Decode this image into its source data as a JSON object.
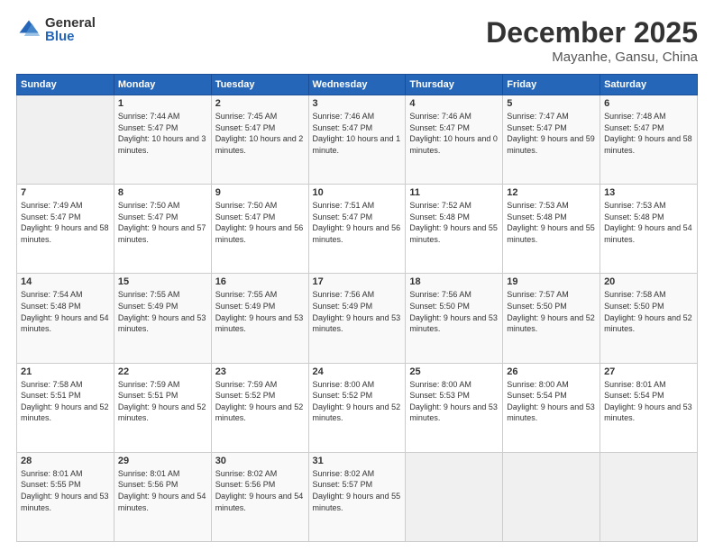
{
  "logo": {
    "general": "General",
    "blue": "Blue"
  },
  "header": {
    "month": "December 2025",
    "location": "Mayanhe, Gansu, China"
  },
  "days_of_week": [
    "Sunday",
    "Monday",
    "Tuesday",
    "Wednesday",
    "Thursday",
    "Friday",
    "Saturday"
  ],
  "weeks": [
    [
      {
        "day": "",
        "sunrise": "",
        "sunset": "",
        "daylight": ""
      },
      {
        "day": "1",
        "sunrise": "Sunrise: 7:44 AM",
        "sunset": "Sunset: 5:47 PM",
        "daylight": "Daylight: 10 hours and 3 minutes."
      },
      {
        "day": "2",
        "sunrise": "Sunrise: 7:45 AM",
        "sunset": "Sunset: 5:47 PM",
        "daylight": "Daylight: 10 hours and 2 minutes."
      },
      {
        "day": "3",
        "sunrise": "Sunrise: 7:46 AM",
        "sunset": "Sunset: 5:47 PM",
        "daylight": "Daylight: 10 hours and 1 minute."
      },
      {
        "day": "4",
        "sunrise": "Sunrise: 7:46 AM",
        "sunset": "Sunset: 5:47 PM",
        "daylight": "Daylight: 10 hours and 0 minutes."
      },
      {
        "day": "5",
        "sunrise": "Sunrise: 7:47 AM",
        "sunset": "Sunset: 5:47 PM",
        "daylight": "Daylight: 9 hours and 59 minutes."
      },
      {
        "day": "6",
        "sunrise": "Sunrise: 7:48 AM",
        "sunset": "Sunset: 5:47 PM",
        "daylight": "Daylight: 9 hours and 58 minutes."
      }
    ],
    [
      {
        "day": "7",
        "sunrise": "Sunrise: 7:49 AM",
        "sunset": "Sunset: 5:47 PM",
        "daylight": "Daylight: 9 hours and 58 minutes."
      },
      {
        "day": "8",
        "sunrise": "Sunrise: 7:50 AM",
        "sunset": "Sunset: 5:47 PM",
        "daylight": "Daylight: 9 hours and 57 minutes."
      },
      {
        "day": "9",
        "sunrise": "Sunrise: 7:50 AM",
        "sunset": "Sunset: 5:47 PM",
        "daylight": "Daylight: 9 hours and 56 minutes."
      },
      {
        "day": "10",
        "sunrise": "Sunrise: 7:51 AM",
        "sunset": "Sunset: 5:47 PM",
        "daylight": "Daylight: 9 hours and 56 minutes."
      },
      {
        "day": "11",
        "sunrise": "Sunrise: 7:52 AM",
        "sunset": "Sunset: 5:48 PM",
        "daylight": "Daylight: 9 hours and 55 minutes."
      },
      {
        "day": "12",
        "sunrise": "Sunrise: 7:53 AM",
        "sunset": "Sunset: 5:48 PM",
        "daylight": "Daylight: 9 hours and 55 minutes."
      },
      {
        "day": "13",
        "sunrise": "Sunrise: 7:53 AM",
        "sunset": "Sunset: 5:48 PM",
        "daylight": "Daylight: 9 hours and 54 minutes."
      }
    ],
    [
      {
        "day": "14",
        "sunrise": "Sunrise: 7:54 AM",
        "sunset": "Sunset: 5:48 PM",
        "daylight": "Daylight: 9 hours and 54 minutes."
      },
      {
        "day": "15",
        "sunrise": "Sunrise: 7:55 AM",
        "sunset": "Sunset: 5:49 PM",
        "daylight": "Daylight: 9 hours and 53 minutes."
      },
      {
        "day": "16",
        "sunrise": "Sunrise: 7:55 AM",
        "sunset": "Sunset: 5:49 PM",
        "daylight": "Daylight: 9 hours and 53 minutes."
      },
      {
        "day": "17",
        "sunrise": "Sunrise: 7:56 AM",
        "sunset": "Sunset: 5:49 PM",
        "daylight": "Daylight: 9 hours and 53 minutes."
      },
      {
        "day": "18",
        "sunrise": "Sunrise: 7:56 AM",
        "sunset": "Sunset: 5:50 PM",
        "daylight": "Daylight: 9 hours and 53 minutes."
      },
      {
        "day": "19",
        "sunrise": "Sunrise: 7:57 AM",
        "sunset": "Sunset: 5:50 PM",
        "daylight": "Daylight: 9 hours and 52 minutes."
      },
      {
        "day": "20",
        "sunrise": "Sunrise: 7:58 AM",
        "sunset": "Sunset: 5:50 PM",
        "daylight": "Daylight: 9 hours and 52 minutes."
      }
    ],
    [
      {
        "day": "21",
        "sunrise": "Sunrise: 7:58 AM",
        "sunset": "Sunset: 5:51 PM",
        "daylight": "Daylight: 9 hours and 52 minutes."
      },
      {
        "day": "22",
        "sunrise": "Sunrise: 7:59 AM",
        "sunset": "Sunset: 5:51 PM",
        "daylight": "Daylight: 9 hours and 52 minutes."
      },
      {
        "day": "23",
        "sunrise": "Sunrise: 7:59 AM",
        "sunset": "Sunset: 5:52 PM",
        "daylight": "Daylight: 9 hours and 52 minutes."
      },
      {
        "day": "24",
        "sunrise": "Sunrise: 8:00 AM",
        "sunset": "Sunset: 5:52 PM",
        "daylight": "Daylight: 9 hours and 52 minutes."
      },
      {
        "day": "25",
        "sunrise": "Sunrise: 8:00 AM",
        "sunset": "Sunset: 5:53 PM",
        "daylight": "Daylight: 9 hours and 53 minutes."
      },
      {
        "day": "26",
        "sunrise": "Sunrise: 8:00 AM",
        "sunset": "Sunset: 5:54 PM",
        "daylight": "Daylight: 9 hours and 53 minutes."
      },
      {
        "day": "27",
        "sunrise": "Sunrise: 8:01 AM",
        "sunset": "Sunset: 5:54 PM",
        "daylight": "Daylight: 9 hours and 53 minutes."
      }
    ],
    [
      {
        "day": "28",
        "sunrise": "Sunrise: 8:01 AM",
        "sunset": "Sunset: 5:55 PM",
        "daylight": "Daylight: 9 hours and 53 minutes."
      },
      {
        "day": "29",
        "sunrise": "Sunrise: 8:01 AM",
        "sunset": "Sunset: 5:56 PM",
        "daylight": "Daylight: 9 hours and 54 minutes."
      },
      {
        "day": "30",
        "sunrise": "Sunrise: 8:02 AM",
        "sunset": "Sunset: 5:56 PM",
        "daylight": "Daylight: 9 hours and 54 minutes."
      },
      {
        "day": "31",
        "sunrise": "Sunrise: 8:02 AM",
        "sunset": "Sunset: 5:57 PM",
        "daylight": "Daylight: 9 hours and 55 minutes."
      },
      {
        "day": "",
        "sunrise": "",
        "sunset": "",
        "daylight": ""
      },
      {
        "day": "",
        "sunrise": "",
        "sunset": "",
        "daylight": ""
      },
      {
        "day": "",
        "sunrise": "",
        "sunset": "",
        "daylight": ""
      }
    ]
  ]
}
